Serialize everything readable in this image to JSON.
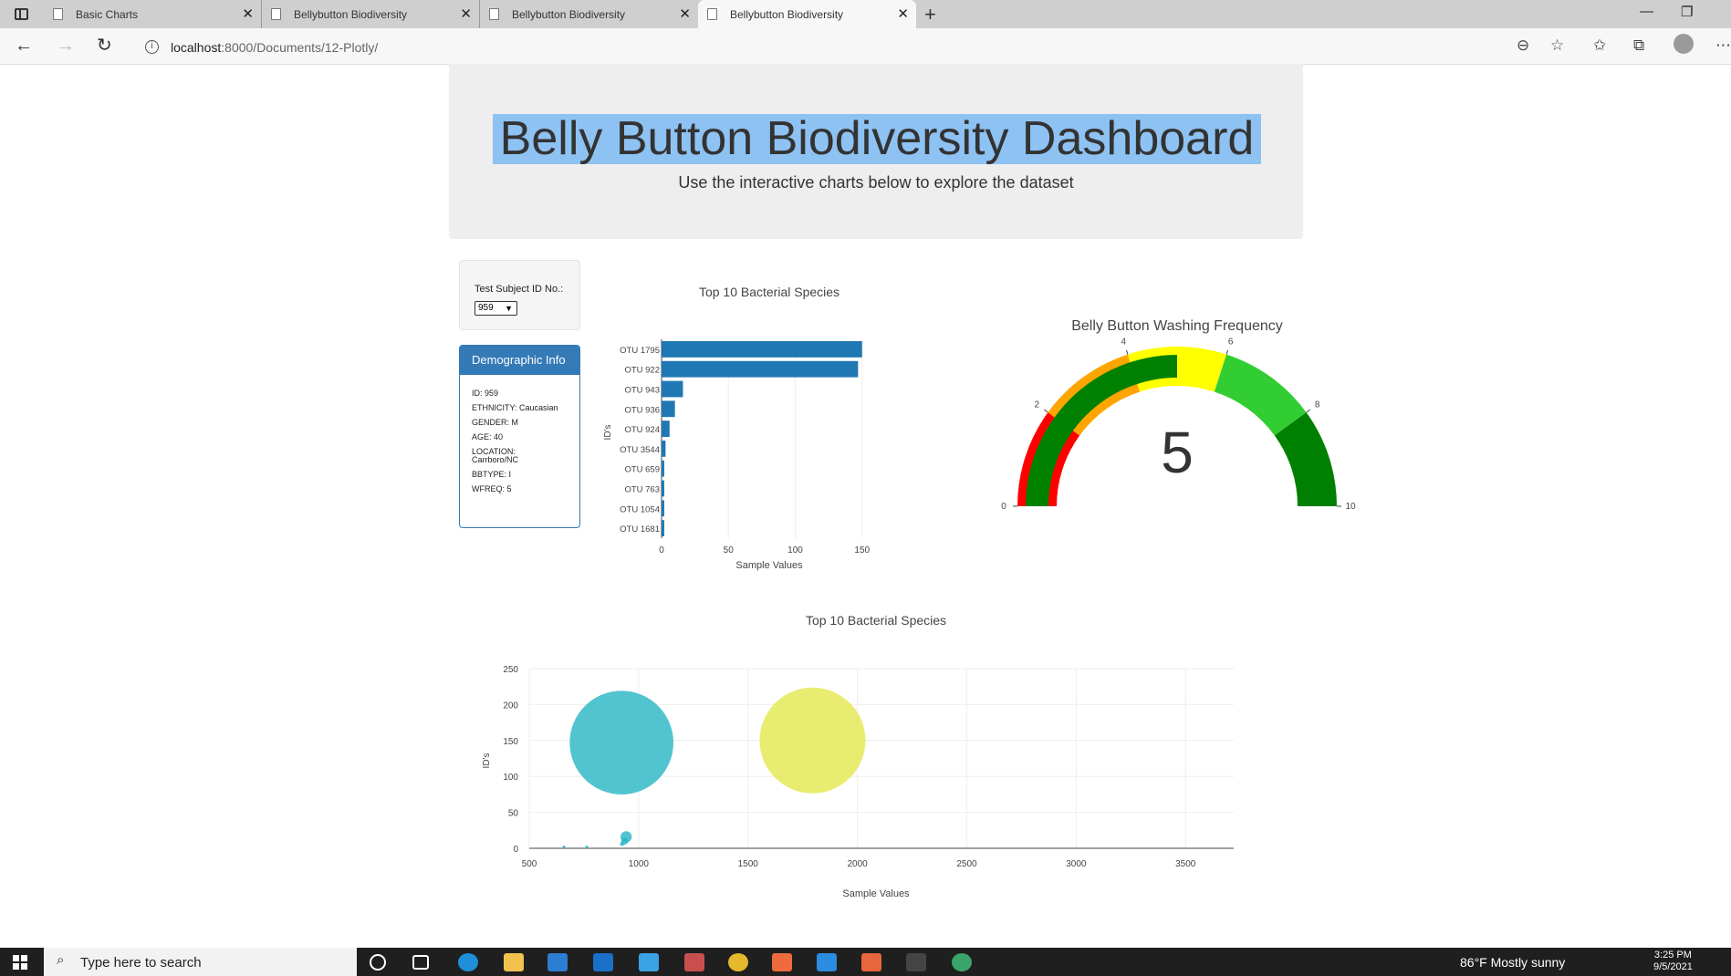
{
  "browser": {
    "tabs": [
      {
        "label": "Basic Charts"
      },
      {
        "label": "Bellybutton Biodiversity"
      },
      {
        "label": "Bellybutton Biodiversity"
      },
      {
        "label": "Bellybutton Biodiversity"
      }
    ],
    "url_host": "localhost",
    "url_path": ":8000/Documents/12-Plotly/"
  },
  "header": {
    "title": "Belly Button Biodiversity Dashboard",
    "subtitle": "Use the interactive charts below to explore the dataset"
  },
  "selector": {
    "label": "Test Subject ID No.:",
    "value": "959"
  },
  "demographics": {
    "heading": "Demographic Info",
    "lines": [
      "ID: 959",
      "ETHNICITY: Caucasian",
      "GENDER: M",
      "AGE: 40",
      "LOCATION: Carrboro/NC",
      "BBTYPE: I",
      "WFREQ: 5"
    ]
  },
  "colors": {
    "bar": "#1f77b4",
    "title_highlight": "#8ec2f3",
    "panel_primary": "#337ab7"
  },
  "chart_data": [
    {
      "type": "bar",
      "orientation": "horizontal",
      "title": "Top 10 Bacterial Species",
      "xlabel": "Sample Values",
      "ylabel": "ID's",
      "categories": [
        "OTU 1795",
        "OTU 922",
        "OTU 943",
        "OTU 936",
        "OTU 924",
        "OTU 3544",
        "OTU 659",
        "OTU 763",
        "OTU 1054",
        "OTU 1681"
      ],
      "values": [
        150,
        147,
        16,
        10,
        6,
        3,
        2,
        2,
        2,
        2
      ],
      "xticks": [
        0,
        50,
        100,
        150
      ],
      "xlim": [
        0,
        157
      ]
    },
    {
      "type": "gauge",
      "title": "Belly Button Washing Frequency",
      "value": 5,
      "range": [
        0,
        10
      ],
      "ticks": [
        0,
        2,
        4,
        6,
        8,
        10
      ],
      "steps": [
        {
          "range": [
            0,
            2
          ],
          "color": "#ff0000"
        },
        {
          "range": [
            2,
            4
          ],
          "color": "#ffa500"
        },
        {
          "range": [
            4,
            6
          ],
          "color": "#ffff00"
        },
        {
          "range": [
            6,
            8
          ],
          "color": "#32cd32"
        },
        {
          "range": [
            8,
            10
          ],
          "color": "#008000"
        }
      ],
      "bar_color": "#008000"
    },
    {
      "type": "scatter",
      "title": "Top 10 Bacterial Species",
      "xlabel": "Sample Values",
      "ylabel": "ID's",
      "xticks": [
        500,
        1000,
        1500,
        2000,
        2500,
        3000,
        3500
      ],
      "yticks": [
        0,
        50,
        100,
        150,
        200,
        250
      ],
      "xlim": [
        500,
        3720
      ],
      "ylim": [
        0,
        250
      ],
      "points": [
        {
          "x": 922,
          "y": 147,
          "r": 147,
          "color": "#26b5c4"
        },
        {
          "x": 1795,
          "y": 150,
          "r": 150,
          "color": "#e2e84e"
        },
        {
          "x": 943,
          "y": 16,
          "r": 16,
          "color": "#26b5c4"
        },
        {
          "x": 936,
          "y": 10,
          "r": 10,
          "color": "#26b5c4"
        },
        {
          "x": 924,
          "y": 6,
          "r": 6,
          "color": "#26b5c4"
        },
        {
          "x": 763,
          "y": 2,
          "r": 2,
          "color": "#26b5c4"
        },
        {
          "x": 659,
          "y": 2,
          "r": 2,
          "color": "#26b5c4"
        }
      ]
    }
  ],
  "taskbar": {
    "search_placeholder": "Type here to search",
    "weather": "86°F  Mostly sunny",
    "time": "3:25 PM",
    "date": "9/5/2021"
  }
}
